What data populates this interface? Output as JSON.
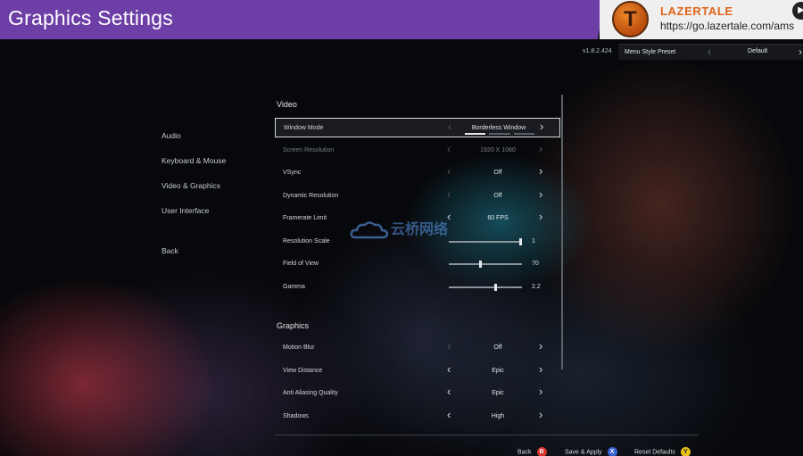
{
  "header": {
    "title": "Graphics Settings",
    "brand_logo_letter": "T",
    "brand_name": "LAZERTALE",
    "brand_url": "https://go.lazertale.com/ams-c"
  },
  "preset": {
    "version": "v1.8.2.424",
    "label": "Menu Style Preset",
    "value": "Default"
  },
  "nav": {
    "items": [
      "Audio",
      "Keyboard & Mouse",
      "Video & Graphics",
      "User Interface",
      "Back"
    ]
  },
  "sections": {
    "video_title": "Video",
    "graphics_title": "Graphics"
  },
  "video_rows": {
    "window_mode": {
      "label": "Window Mode",
      "value": "Borderless Window"
    },
    "screen_resolution": {
      "label": "Screen Resolution",
      "value": "1920 X 1080"
    },
    "vsync": {
      "label": "VSync",
      "value": "Off"
    },
    "dynamic_resolution": {
      "label": "Dynamic Resolution",
      "value": "Off"
    },
    "framerate_limit": {
      "label": "Framerate Limit",
      "value": "60 FPS"
    },
    "resolution_scale": {
      "label": "Resolution Scale",
      "value": "1",
      "fraction": 0.98
    },
    "field_of_view": {
      "label": "Field of View",
      "value": "70",
      "fraction": 0.43
    },
    "gamma": {
      "label": "Gamma",
      "value": "2.2",
      "fraction": 0.63
    }
  },
  "graphics_rows": {
    "motion_blur": {
      "label": "Motion Blur",
      "value": "Off"
    },
    "view_distance": {
      "label": "View Distance",
      "value": "Epic"
    },
    "anti_aliasing": {
      "label": "Anti Aliasing Quality",
      "value": "Epic"
    },
    "shadows": {
      "label": "Shadows",
      "value": "High"
    }
  },
  "footer": {
    "back": {
      "label": "Back",
      "glyph": "B",
      "color": "#d8322e"
    },
    "save": {
      "label": "Save & Apply",
      "glyph": "X",
      "color": "#3a62d6"
    },
    "reset": {
      "label": "Reset Defaults",
      "glyph": "Y",
      "color": "#e8c21a"
    }
  },
  "watermark": {
    "text": "云桥网络"
  },
  "colors": {
    "title_bar": "#6c3ea6",
    "brand_orange": "#e0641c"
  }
}
